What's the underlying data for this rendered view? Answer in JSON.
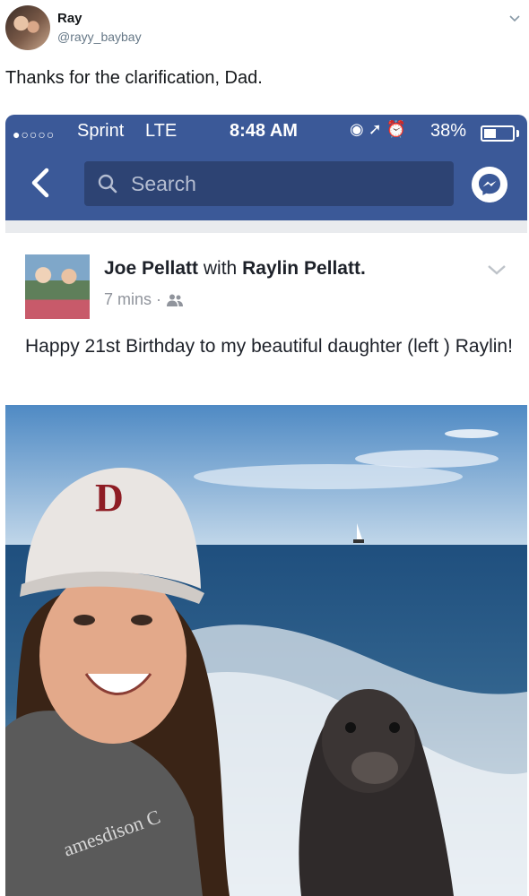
{
  "tweet": {
    "display_name": "Ray",
    "handle": "@rayy_baybay",
    "text": "Thanks for the clarification, Dad."
  },
  "status_bar": {
    "signal": "●○○○○",
    "carrier": "Sprint",
    "network": "LTE",
    "time": "8:48 AM",
    "icons": "◉ ➚ ⏰",
    "battery": "38%"
  },
  "fb_header": {
    "search_placeholder": "Search"
  },
  "post": {
    "author": "Joe Pellatt",
    "with_word": "with",
    "tagged": "Raylin Pellatt.",
    "time": "7 mins",
    "separator": "·",
    "text": "Happy 21st Birthday to my beautiful daughter (left ) Raylin!"
  },
  "photo": {
    "shirt_text": "amesdison C"
  },
  "colors": {
    "facebook_blue": "#3b5998",
    "search_box": "#2d4373",
    "tweet_handle": "#657786",
    "fb_meta_gray": "#90949c"
  }
}
